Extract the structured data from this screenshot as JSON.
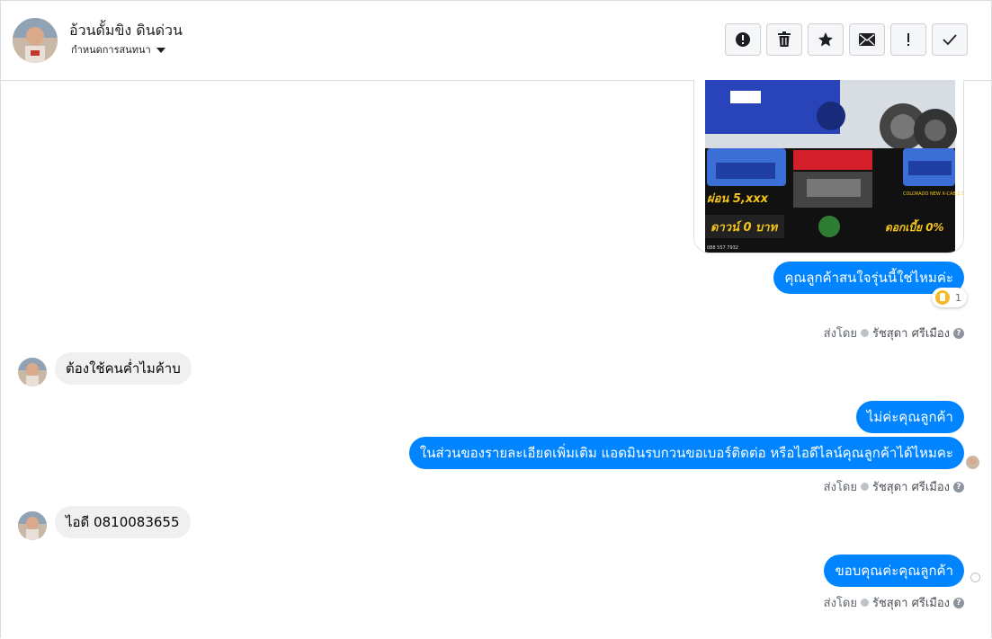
{
  "header": {
    "contact_name": "อ้วนดั้มขิง ดินด่วน",
    "assign_label": "กำหนดการสนทนา",
    "actions": [
      {
        "name": "report-spam-button",
        "icon": "alert-circle-icon"
      },
      {
        "name": "delete-button",
        "icon": "trash-icon"
      },
      {
        "name": "star-button",
        "icon": "star-icon"
      },
      {
        "name": "mark-unread-button",
        "icon": "envelope-icon"
      },
      {
        "name": "follow-up-button",
        "icon": "exclamation-icon"
      },
      {
        "name": "mark-done-button",
        "icon": "check-icon"
      }
    ]
  },
  "promo_image": {
    "price_text": "ผ่อน 5,xxx",
    "down_text": "ดาวน์ 0 บาท",
    "interest_text": "ดอกเบี้ย 0%",
    "model_text": "COLORADO NEW X-CAB 2.5 LT FST (MY18) MT ตัวท็อป 2014",
    "phone_text": "088 557 7932"
  },
  "messages": [
    {
      "direction": "out",
      "text": "คุณลูกค้าสนใจรุ่นนี้ใช่ไหมค่ะ"
    },
    {
      "direction": "in",
      "text": "ต้องใช้คนค่ำไมค้าบ"
    },
    {
      "direction": "out",
      "text": "ไม่ค่ะคุณลูกค้า"
    },
    {
      "direction": "out",
      "text": "ในส่วนของรายละเอียดเพิ่มเติม แอดมินรบกวนขอเบอร์ติดต่อ หรือไอดีไลน์คุณลูกค้าได้ไหมคะ"
    },
    {
      "direction": "in",
      "text": "ไอดี  0810083655"
    },
    {
      "direction": "out",
      "text": "ขอบคุณค่ะคุณลูกค้า"
    }
  ],
  "reaction": {
    "icon": "thumbs-up-icon",
    "count": "1"
  },
  "sent_by": {
    "label": "ส่งโดย",
    "agent": "รัชสุดา ศรีเมือง",
    "help_icon": "?"
  },
  "colors": {
    "outgoing_bubble": "#0084ff",
    "incoming_bubble": "#f0f0f0",
    "border": "#dadde1"
  }
}
